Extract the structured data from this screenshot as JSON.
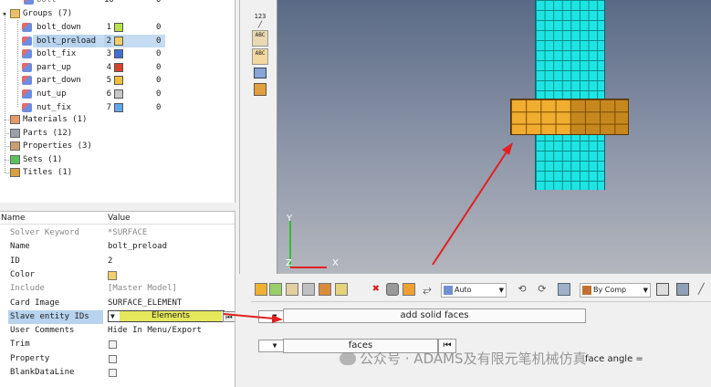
{
  "tree": {
    "partial_top": {
      "label": "bolt",
      "id": "10",
      "zero": "0"
    },
    "groups_header": "Groups (7)",
    "groups": [
      {
        "label": "bolt_down",
        "id": "1",
        "color": "#b7e04a",
        "zero": "0"
      },
      {
        "label": "bolt_preload",
        "id": "2",
        "color": "#f3cf6a",
        "zero": "0",
        "selected": true
      },
      {
        "label": "bolt_fix",
        "id": "3",
        "color": "#3f6fd1",
        "zero": "0"
      },
      {
        "label": "part_up",
        "id": "4",
        "color": "#d8432b",
        "zero": "0"
      },
      {
        "label": "part_down",
        "id": "5",
        "color": "#f0c03a",
        "zero": "0"
      },
      {
        "label": "nut_up",
        "id": "6",
        "color": "#c8c8c8",
        "zero": "0"
      },
      {
        "label": "nut_fix",
        "id": "7",
        "color": "#5fa7e8",
        "zero": "0"
      }
    ],
    "collections": [
      {
        "label": "Materials (1)"
      },
      {
        "label": "Parts (12)"
      },
      {
        "label": "Properties (3)"
      },
      {
        "label": "Sets (1)"
      },
      {
        "label": "Titles (1)"
      }
    ]
  },
  "props": {
    "header_name": "Name",
    "header_value": "Value",
    "rows": [
      {
        "name": "Solver Keyword",
        "value": "*SURFACE",
        "muted": true
      },
      {
        "name": "Name",
        "value": "bolt_preload"
      },
      {
        "name": "ID",
        "value": "2"
      },
      {
        "name": "Color",
        "value": ""
      },
      {
        "name": "Include",
        "value": "[Master Model]",
        "muted": true
      },
      {
        "name": "Card Image",
        "value": "SURFACE_ELEMENT"
      },
      {
        "name": "Slave entity IDs",
        "value": ""
      },
      {
        "name": "User Comments",
        "value": "Hide In Menu/Export"
      },
      {
        "name": "Trim",
        "value": ""
      },
      {
        "name": "Property",
        "value": ""
      },
      {
        "name": "BlankDataLine",
        "value": ""
      }
    ],
    "slave_dropdown": "Elements",
    "first_btn": "⏮"
  },
  "vtoolbar": {
    "btn1": "123",
    "btn3": "ABC",
    "btn4": "ABC"
  },
  "viewport": {
    "axis_y": "Y",
    "axis_x": "X",
    "axis_z": "Z"
  },
  "htoolbar": {
    "auto_label": "Auto",
    "bycomp_label": "By Comp"
  },
  "bottom": {
    "dd1": "▼",
    "add_solid_faces": "add solid faces",
    "dd2": "▼",
    "faces_label": "faces",
    "faces_first": "⏮",
    "face_angle": "face angle ="
  },
  "watermark": "公众号 · ADAMS及有限元笔机械仿真",
  "colors": {
    "bolt": "#1ee5e3",
    "nut": "#f0ad2f",
    "arrow": "#e02020"
  }
}
